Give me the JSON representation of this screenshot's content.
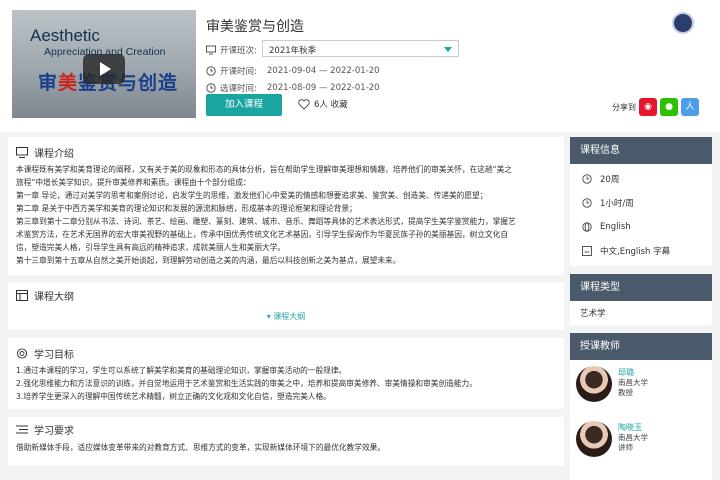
{
  "cover": {
    "line1": "Aesthetic",
    "line2": "Appreciation and Creation",
    "line3a": "审",
    "line3b": "美",
    "line3c": "鉴赏与创造"
  },
  "course": {
    "title": "审美鉴赏与创造",
    "term_label": "开课班次:",
    "term_value": "2021年秋季",
    "open_label": "开课时间:",
    "open_value": "2021-09-04 — 2022-01-20",
    "select_label": "选课时间:",
    "select_value": "2021-08-09 — 2022-01-20",
    "enroll_button": "加入课程",
    "favorites": "6人 收藏",
    "share_label": "分享到"
  },
  "intro": {
    "heading": "课程介绍",
    "lines": [
      "本课程既有美学和美育理论的阐释，又有关于美的现象和形态的具体分析，旨在帮助学生理解审美理想和情趣，培养他们的审美关怀，在这趟“美之",
      "旅程”中增长美学知识，提升审美修养和素质。课程由十个部分组成：",
      "    第一章 导论，通过对美学的思考和案例讨论，启发学生的思维，激发他们心中爱美的情感和想要追求美、鉴赏美、创造美、传递美的愿望；",
      "    第二章 是关于中西方美学和美育的理论知识和发展的源流和脉络，形成基本的理论框架和理论背景；",
      "第三章到第十二章分别从书法、诗词、茶艺、绘画、雕塑、篆刻、建筑、城市、音乐、舞蹈等具体的艺术表达形式，提高学生美学鉴赏能力，掌握艺",
      "术鉴赏方法，在艺术无国界的宏大审美视野的基础上，传承中国优秀传统文化艺术基因，引导学生探询作为华夏民族子孙的美丽基因，树立文化自",
      "信，塑造完美人格，引导学生具有高远的精神追求，成就美丽人生和美丽大学。",
      "第十三章到第十五章从自然之美开始谈起，到理解劳动创造之美的内涵，最后以科技创新之美为基点，展望未来。"
    ]
  },
  "outline": {
    "heading": "课程大纲",
    "link": "课程大纲"
  },
  "goals": {
    "heading": "学习目标",
    "lines": [
      "1.通过本课程的学习，学生可以系统了解美学和美育的基础理论知识，掌握审美活动的一般规律。",
      "2.强化思维能力和方法意识的训练，并自觉地运用于艺术鉴赏和生活实践的审美之中，培养和提高审美修养、审美情操和审美创造能力。",
      "3.培养学生更深入的理解中国传统艺术精髓，树立正确的文化观和文化自信，塑造完美人格。"
    ]
  },
  "requirements": {
    "heading": "学习要求",
    "lines": [
      "借助新媒体手段，适应媒体变革带来的对教育方式、思维方式的变革，实现新媒体环境下的最优化教学效果。"
    ]
  },
  "sidebar": {
    "info_heading": "课程信息",
    "info": [
      "20周",
      "1小时/周",
      "English",
      "中文,English 字幕"
    ],
    "type_heading": "课程类型",
    "type_value": "艺术学",
    "teachers_heading": "授课教师",
    "teachers": [
      {
        "name": "邱璐",
        "org": "南昌大学",
        "title": "教授"
      },
      {
        "name": "陶晓玉",
        "org": "南昌大学",
        "title": "讲师"
      }
    ]
  },
  "colors": {
    "accent": "#1aa5a1",
    "sidebar_header": "#4a5a6a"
  }
}
